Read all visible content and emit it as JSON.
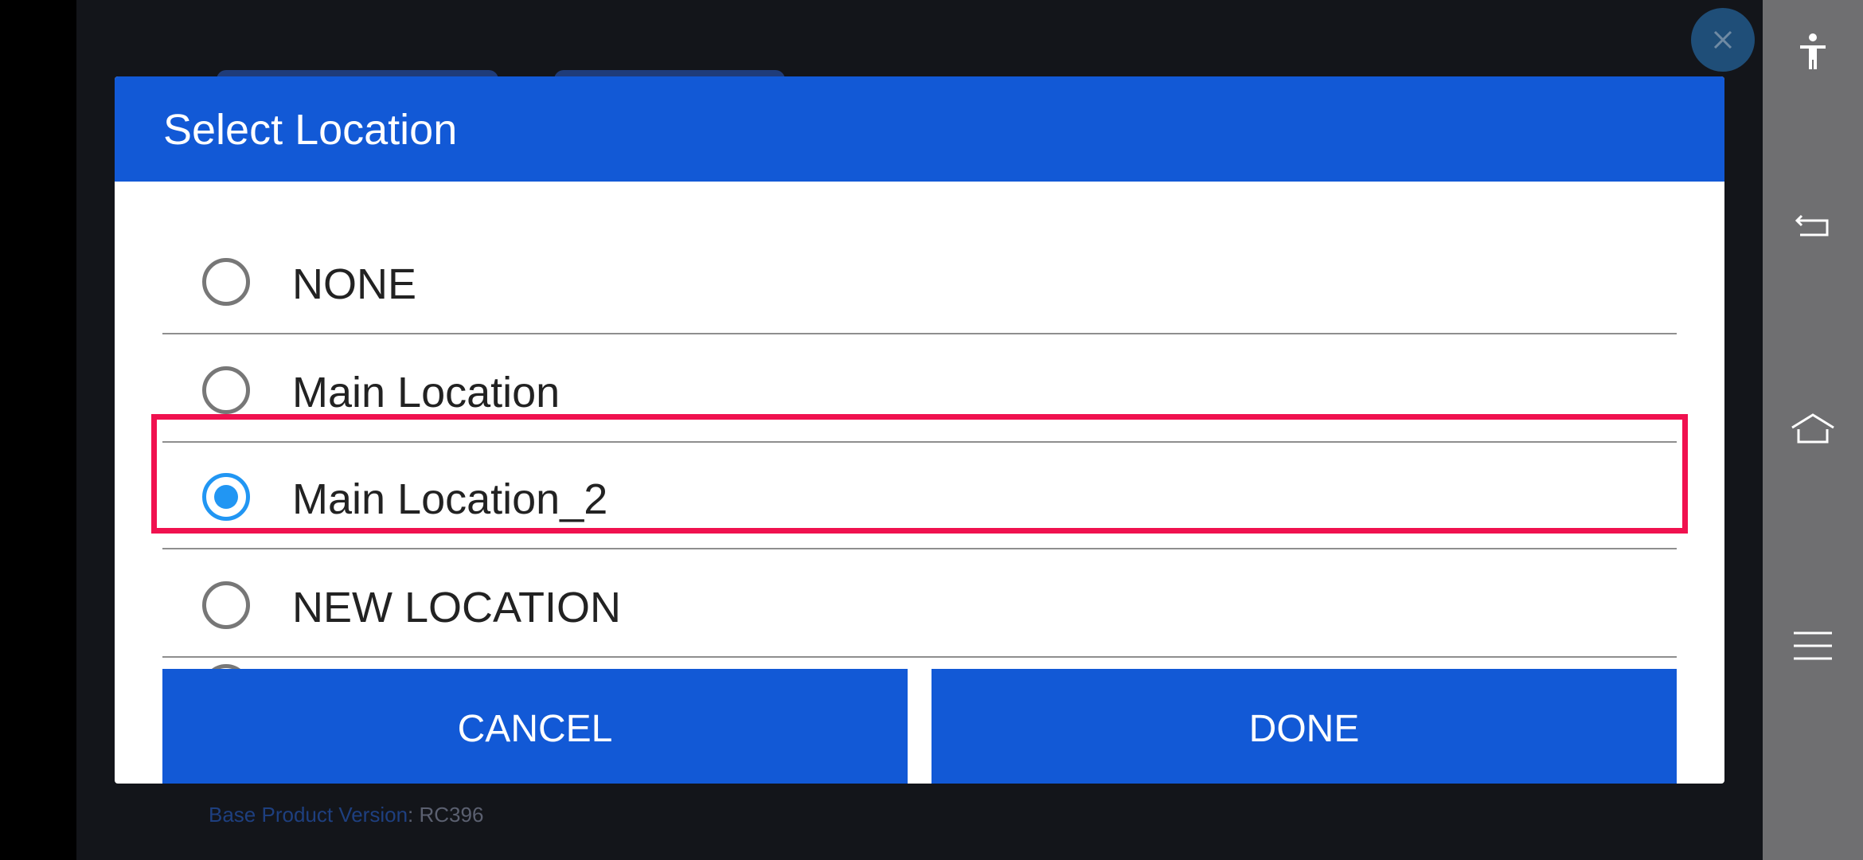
{
  "dialog": {
    "title": "Select Location",
    "options": [
      {
        "label": "NONE",
        "selected": false
      },
      {
        "label": "Main Location",
        "selected": false
      },
      {
        "label": "Main Location_2",
        "selected": true
      },
      {
        "label": "NEW LOCATION",
        "selected": false
      }
    ],
    "cancel_label": "CANCEL",
    "done_label": "DONE"
  },
  "background": {
    "version_label": "Base Product Version",
    "version_value": ": RC396"
  },
  "nav_rail": {
    "icons": [
      "accessibility-icon",
      "back-icon",
      "home-icon",
      "menu-icon"
    ]
  },
  "colors": {
    "accent": "#1259d6",
    "radio_selected": "#2196f3",
    "highlight": "#f0114f"
  }
}
